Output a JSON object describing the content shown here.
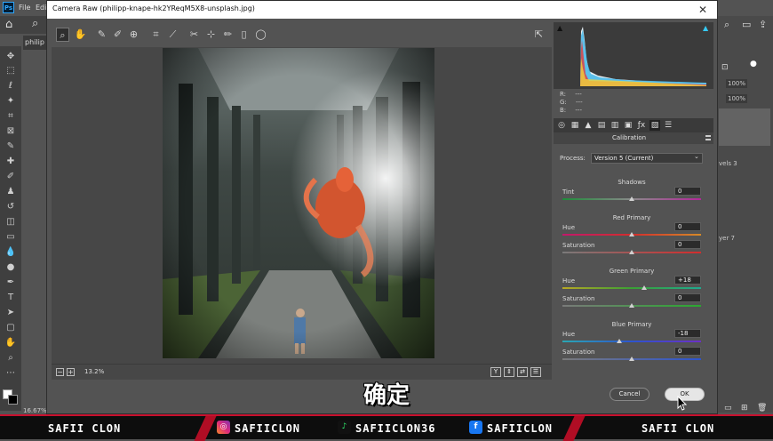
{
  "photoshop": {
    "menu": [
      "File",
      "Edi"
    ],
    "doc_tab": "philip",
    "zoom_level": "16.67%",
    "right_panel": {
      "opacity_1": "100%",
      "opacity_2": "100%",
      "layer_a": "vels 3",
      "layer_b": "yer 7"
    }
  },
  "dialog": {
    "title": "Camera Raw (philipp-knape-hk2YReqM5X8-unsplash.jpg)",
    "close": "✕",
    "zoom_value": "13.2%",
    "rgb": {
      "r_label": "R:",
      "g_label": "G:",
      "b_label": "B:",
      "r": "---",
      "g": "---",
      "b": "---"
    },
    "panel_title": "Calibration",
    "process_label": "Process:",
    "process_value": "Version 5 (Current)",
    "shadows": {
      "title": "Shadows",
      "tint_label": "Tint",
      "tint_value": "0"
    },
    "red_primary": {
      "title": "Red Primary",
      "hue_label": "Hue",
      "hue_value": "0",
      "sat_label": "Saturation",
      "sat_value": "0"
    },
    "green_primary": {
      "title": "Green Primary",
      "hue_label": "Hue",
      "hue_value": "+18",
      "sat_label": "Saturation",
      "sat_value": "0"
    },
    "blue_primary": {
      "title": "Blue Primary",
      "hue_label": "Hue",
      "hue_value": "-18",
      "sat_label": "Saturation",
      "sat_value": "0"
    },
    "cancel_label": "Cancel",
    "ok_label": "OK",
    "preview_view_buttons": [
      "Y",
      "⇕",
      "⇄",
      "☰"
    ]
  },
  "subtitle": "确定",
  "banner": {
    "left_name": "SAFII CLON",
    "instagram": "SAFIICLON",
    "tiktok": "SAFIICLON36",
    "facebook": "SAFIICLON",
    "right_name": "SAFII CLON",
    "accent_color": "#c8102e"
  },
  "icons": [
    "zoom-icon",
    "hand-icon",
    "white-balance-icon",
    "color-sampler-icon",
    "target-adjust-icon",
    "crop-icon",
    "straighten-icon",
    "spot-removal-icon",
    "redeye-icon",
    "brush-icon",
    "graduated-filter-icon",
    "radial-filter-icon",
    "open-preferences-icon"
  ]
}
